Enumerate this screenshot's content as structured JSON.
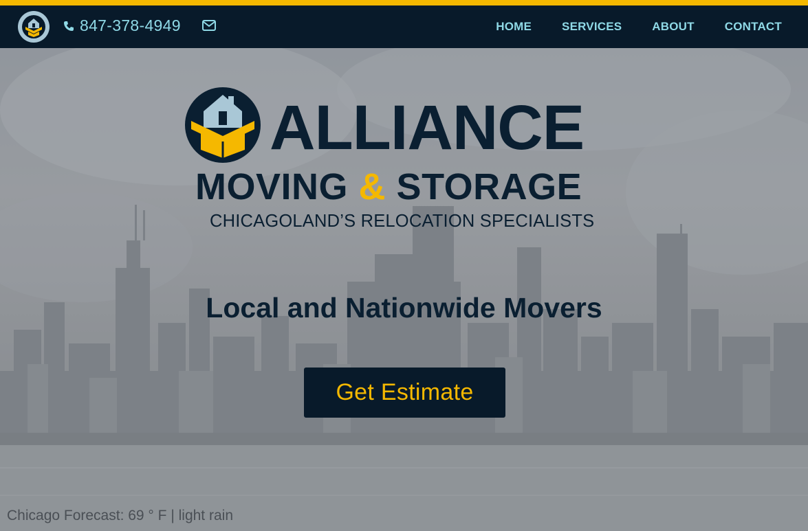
{
  "colors": {
    "accent": "#f5b800",
    "navy": "#081a2a",
    "nav_text": "#8fd9e6"
  },
  "header": {
    "logo_icon": "house-in-box-icon",
    "phone_icon": "phone-icon",
    "phone": "847-378-4949",
    "mail_icon": "envelope-icon",
    "nav": [
      "HOME",
      "SERVICES",
      "ABOUT",
      "CONTACT"
    ]
  },
  "brand": {
    "name": "ALLIANCE",
    "line2_left": "MOVING",
    "line2_amp": "&",
    "line2_right": "STORAGE",
    "tagline": "CHICAGOLAND’S RELOCATION SPECIALISTS"
  },
  "hero": {
    "headline": "Local and Nationwide Movers",
    "cta": "Get Estimate",
    "forecast": "Chicago Forecast: 69 ° F | light rain"
  }
}
